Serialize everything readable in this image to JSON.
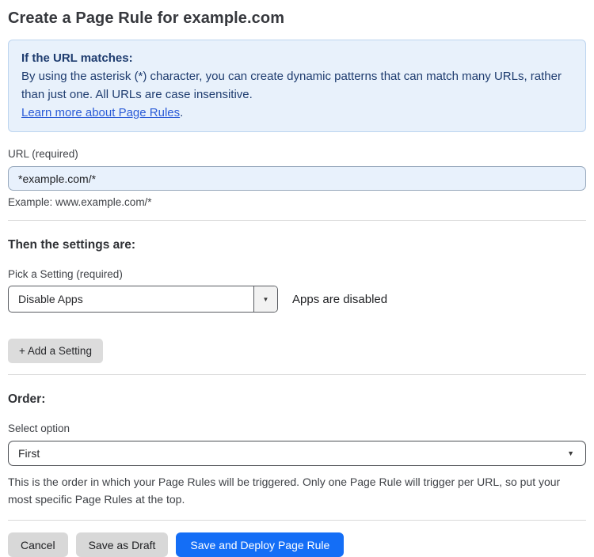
{
  "page": {
    "title": "Create a Page Rule for example.com"
  },
  "info_box": {
    "heading": "If the URL matches:",
    "body": "By using the asterisk (*) character, you can create dynamic patterns that can match many URLs, rather than just one. All URLs are case insensitive.",
    "link_label": "Learn more about Page Rules",
    "link_suffix": "."
  },
  "url_field": {
    "label": "URL (required)",
    "value": "*example.com/*",
    "example": "Example: www.example.com/*"
  },
  "settings_section": {
    "heading": "Then the settings are:",
    "pick_label": "Pick a Setting (required)",
    "selected_setting": "Disable Apps",
    "status_text": "Apps are disabled",
    "add_setting_label": "+ Add a Setting"
  },
  "order_section": {
    "heading": "Order:",
    "select_label": "Select option",
    "selected_option": "First",
    "help_text": "This is the order in which your Page Rules will be triggered. Only one Page Rule will trigger per URL, so put your most specific Page Rules at the top."
  },
  "actions": {
    "cancel_label": "Cancel",
    "save_draft_label": "Save as Draft",
    "save_deploy_label": "Save and Deploy Page Rule"
  },
  "icons": {
    "dropdown_arrow": "▼"
  },
  "colors": {
    "primary_blue": "#146ef6",
    "info_bg": "#e8f1fb",
    "info_border": "#bcd4ef",
    "info_text": "#1e3c6f",
    "link_blue": "#2a5bd7",
    "input_bg": "#e8f1fc"
  }
}
